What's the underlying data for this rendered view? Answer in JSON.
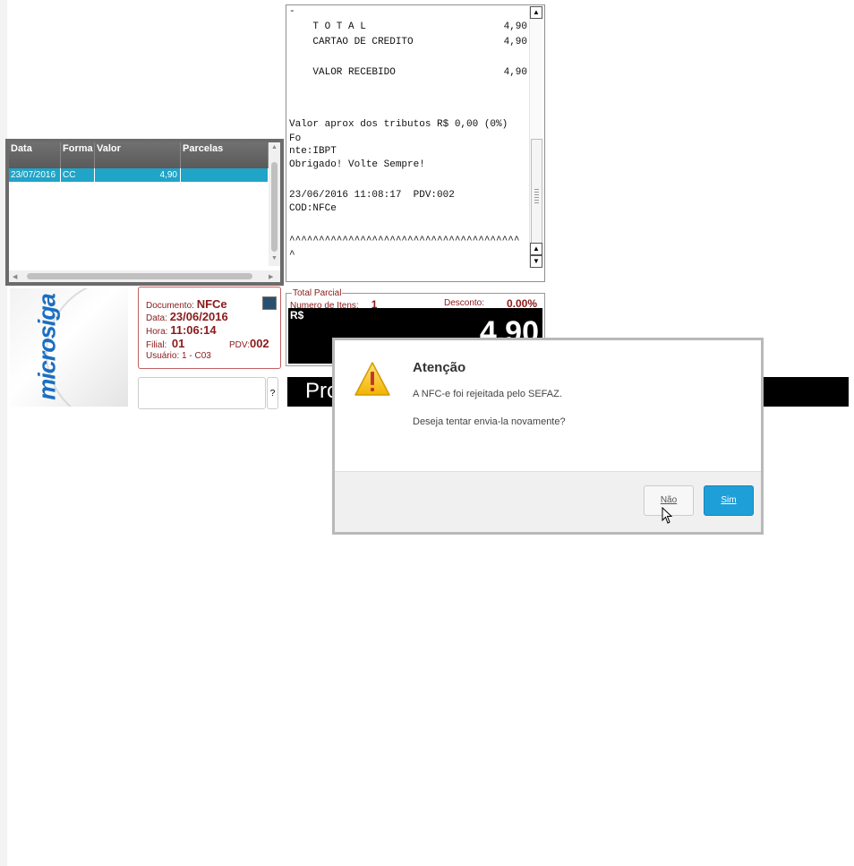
{
  "receipt": {
    "lines": [
      {
        "text": "-",
        "amount": ""
      },
      {
        "text": "    T O T A L",
        "amount": "4,90"
      },
      {
        "text": "    CARTAO DE CREDITO",
        "amount": "4,90"
      },
      {
        "text": "",
        "amount": ""
      },
      {
        "text": "    VALOR RECEBIDO",
        "amount": "4,90"
      },
      {
        "text": "",
        "amount": ""
      },
      {
        "text": "",
        "amount": ""
      },
      {
        "text": "",
        "amount": ""
      },
      {
        "text": "Valor aprox dos tributos R$ 0,00 (0%)",
        "amount": ""
      },
      {
        "text": "Fo",
        "amount": ""
      },
      {
        "text": "nte:IBPT",
        "amount": ""
      },
      {
        "text": "Obrigado! Volte Sempre!",
        "amount": ""
      },
      {
        "text": "",
        "amount": ""
      },
      {
        "text": "23/06/2016 11:08:17  PDV:002",
        "amount": ""
      },
      {
        "text": "COD:NFCe",
        "amount": ""
      },
      {
        "text": "",
        "amount": ""
      },
      {
        "text": "^^^^^^^^^^^^^^^^^^^^^^^^^^^^^^^^^^^^^^^",
        "amount": ""
      },
      {
        "text": "^",
        "amount": ""
      }
    ]
  },
  "grid": {
    "headers": [
      "Data",
      "Forma",
      "Valor",
      "Parcelas"
    ],
    "row": {
      "data": "23/07/2016",
      "forma": "CC",
      "valor": "4,90",
      "parcelas": ""
    }
  },
  "doc": {
    "documento_label": "Documento:",
    "documento_value": "NFCe",
    "data_label": "Data:",
    "data_value": "23/06/2016",
    "hora_label": "Hora:",
    "hora_value": "11:06:14",
    "filial_label": "Filial:",
    "filial_value": "01",
    "pdv_label": "PDV:",
    "pdv_value": "002",
    "usuario_label": "Usuário:",
    "usuario_value": "1 - C03"
  },
  "help_label": "?",
  "logo": {
    "text": "microsiga"
  },
  "total": {
    "legend": "Total Parcial",
    "items_label": "Numero de Itens:",
    "items_value": "1",
    "desconto_label": "Desconto:",
    "desconto_value": "0.00%",
    "currency": "R$",
    "value": "4,90"
  },
  "product_bar": {
    "label": "Pro"
  },
  "dialog": {
    "title": "Atenção",
    "message1": "A NFC-e foi rejeitada pelo SEFAZ.",
    "message2": "Deseja tentar envia-la novamente?",
    "no_label": "Não",
    "yes_label": "Sim"
  },
  "icons": [
    "warning-icon",
    "monitor-icon",
    "cursor-icon",
    "scroll-up-icon",
    "scroll-down-icon"
  ]
}
